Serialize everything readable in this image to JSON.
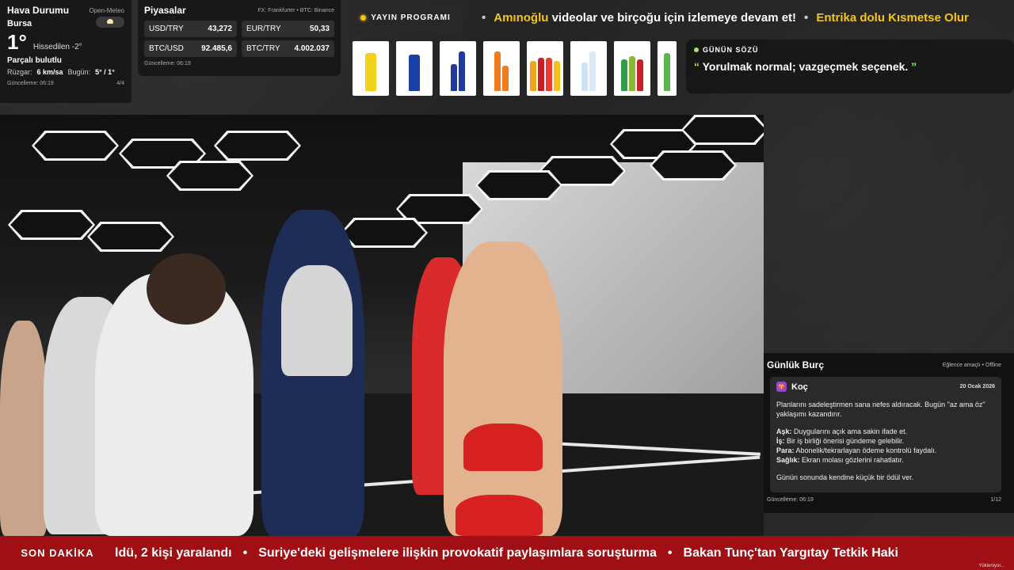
{
  "weather": {
    "title": "Hava Durumu",
    "source": "Open-Meteo",
    "city": "Bursa",
    "temp": "1°",
    "feels": "Hissedilen -2°",
    "desc": "Parçalı bulutlu",
    "wind_label": "Rüzgar:",
    "wind_value": "6 km/sa",
    "today_label": "Bugün:",
    "today_value": "5° / 1°",
    "updated": "Güncelleme: 06:19",
    "page": "4/4",
    "icon": "partly-cloudy-icon"
  },
  "markets": {
    "title": "Piyasalar",
    "source": "FX: Frankfurter • BTC: Binance",
    "items": [
      {
        "label": "USD/TRY",
        "value": "43,272"
      },
      {
        "label": "EUR/TRY",
        "value": "50,33"
      },
      {
        "label": "BTC/USD",
        "value": "92.485,6"
      },
      {
        "label": "BTC/TRY",
        "value": "4.002.037"
      }
    ],
    "updated": "Güncelleme: 06:19"
  },
  "program": {
    "badge": "YAYIN PROGRAMI",
    "item1_hl": "Amınoğlu",
    "item1_rest": " videolar ve birçoğu için izlemeye devam et!",
    "sep": "•",
    "item2_hl": "Entrika dolu Kısmetse Olur"
  },
  "quote": {
    "title": "GÜNÜN SÖZÜ",
    "open": "❞",
    "text": " Yorulmak normal; vazgeçmek seçenek. ",
    "close": "❞"
  },
  "horoscope": {
    "title": "Günlük Burç",
    "meta": "Eğlence amaçlı • Offline",
    "sign": "Koç",
    "sign_icon": "♈",
    "date": "20 Ocak 2026",
    "intro": "Planlarını sadeleştirmen sana nefes aldıracak. Bugün \"az ama öz\" yaklaşımı kazandırır.",
    "love_label": "Aşk:",
    "love": " Duygularını açık ama sakin ifade et.",
    "work_label": "İş:",
    "work": " Bir iş birliği önerisi gündeme gelebilir.",
    "money_label": "Para:",
    "money": " Abonelik/tekrarlayan ödeme kontrolü faydalı.",
    "health_label": "Sağlık:",
    "health": " Ekran molası gözlerini rahatlatır.",
    "closing": "Günün sonunda kendine küçük bir ödül ver.",
    "updated": "Güncelleme: 06:19",
    "page": "1/12"
  },
  "news": {
    "badge": "SON DAKİKA",
    "item1": "ldü, 2 kişi yaralandı",
    "sep": "•",
    "item2": "Suriye'deki gelişmelere ilişkin provokatif paylaşımlara soruşturma",
    "item3": "Bakan Tunç'tan Yargıtay Tetkik Haki",
    "loading": "Yükleniyor..."
  },
  "colors": {
    "accent": "#f5c518",
    "news_bg": "#a00f14",
    "quote_accent": "#9fe870"
  }
}
